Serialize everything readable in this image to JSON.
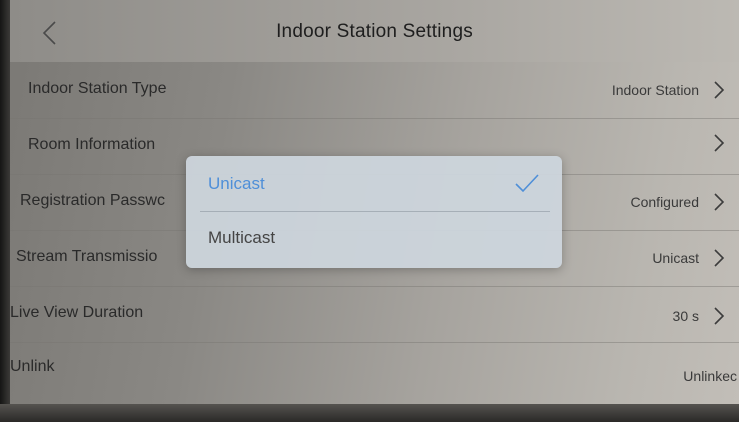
{
  "header": {
    "title": "Indoor Station Settings"
  },
  "rows": [
    {
      "label": "Indoor Station Type",
      "value": "Indoor Station"
    },
    {
      "label": "Room Information",
      "value": ""
    },
    {
      "label": "Registration Passwc",
      "value": "Configured"
    },
    {
      "label": "Stream Transmissio",
      "value": "Unicast"
    },
    {
      "label": "Live View Duration",
      "value": "30 s"
    },
    {
      "label": "Unlink",
      "value": "Unlinkec"
    }
  ],
  "popup": {
    "options": [
      {
        "label": "Unicast",
        "selected": true
      },
      {
        "label": "Multicast",
        "selected": false
      }
    ]
  },
  "colors": {
    "accent": "#4f8fd8",
    "text": "#2a2a2a",
    "popup_bg": "#cdd6de"
  },
  "icons": {
    "back": "chevron-left-icon",
    "row_arrow": "chevron-right-icon",
    "selected": "check-icon"
  }
}
